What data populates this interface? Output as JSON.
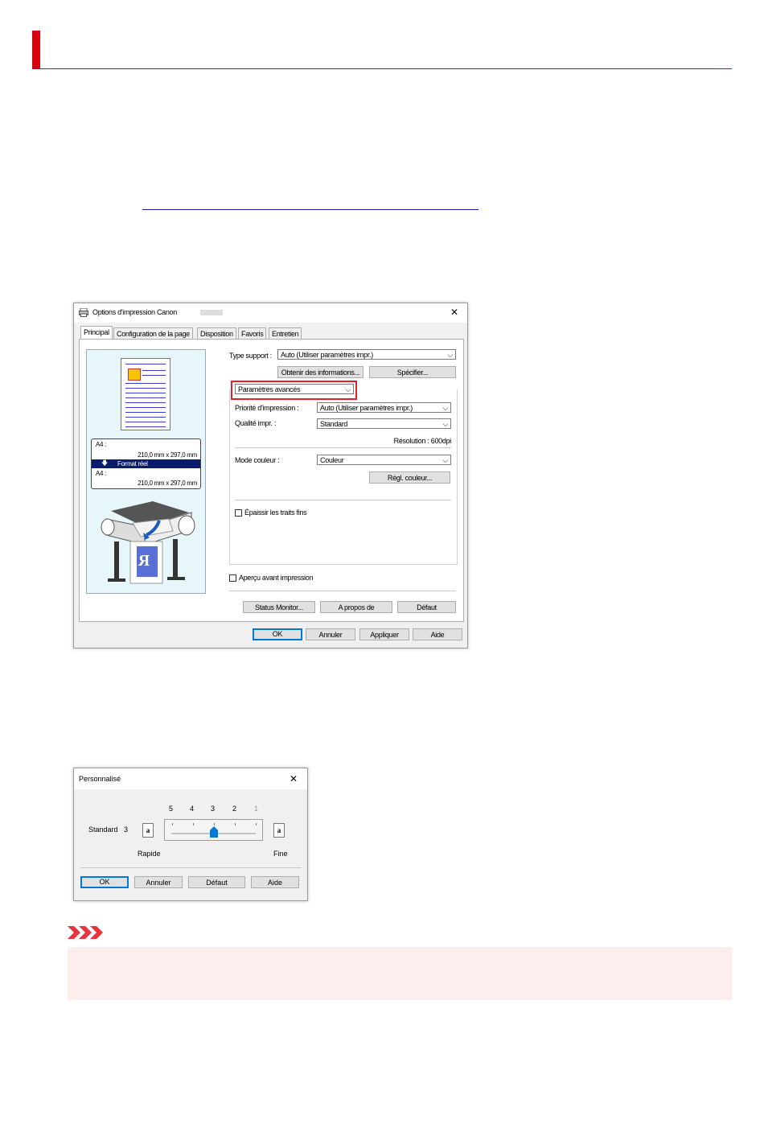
{
  "dialog_main": {
    "title": "Options d'impression Canon",
    "close": "✕",
    "tabs": [
      "Principal",
      "Configuration de la page",
      "Disposition",
      "Favoris",
      "Entretien"
    ],
    "media_type_label": "Type support :",
    "media_type_value": "Auto (Utiliser paramètres impr.)",
    "get_info_button": "Obtenir des informations...",
    "specify_button": "Spécifier...",
    "settings_mode_value": "Paramètres avancés",
    "print_priority_label": "Priorité d'impression :",
    "print_priority_value": "Auto (Utiliser paramètres impr.)",
    "print_quality_label": "Qualité impr. :",
    "print_quality_value": "Standard",
    "resolution_text": "Résolution : 600dpi",
    "color_mode_label": "Mode couleur :",
    "color_mode_value": "Couleur",
    "color_settings_button": "Régl. couleur...",
    "thicken_lines_label": "Épaissir les traits fins",
    "preview_label": "Aperçu avant impression",
    "status_monitor_button": "Status Monitor...",
    "about_button": "A propos de",
    "default_button": "Défaut",
    "ok_button": "OK",
    "cancel_button": "Annuler",
    "apply_button": "Appliquer",
    "help_button": "Aide",
    "size_box": {
      "line1_label": "A4 :",
      "line1_size": "210,0 mm x 297,0 mm",
      "real_size_label": "Format réel",
      "line2_label": "A4 :",
      "line2_size": "210,0 mm x 297,0 mm"
    },
    "preview_glyph": "R"
  },
  "dialog_custom": {
    "title": "Personnalisé",
    "close": "✕",
    "quality_label": "Standard",
    "quality_value": "3",
    "scale": [
      "5",
      "4",
      "3",
      "2",
      "1"
    ],
    "slider_level": 3,
    "left_icon": "a",
    "right_icon": "a",
    "fast_label": "Rapide",
    "fine_label": "Fine",
    "ok_button": "OK",
    "cancel_button": "Annuler",
    "default_button": "Défaut",
    "help_button": "Aide"
  },
  "colors": {
    "accent_red": "#d7000f",
    "link_blue": "#1a1ab3",
    "warning_bg": "#fdeded",
    "warning_icon": "#e8323c"
  },
  "icons": [
    "printer-icon",
    "important-chevrons-icon"
  ]
}
